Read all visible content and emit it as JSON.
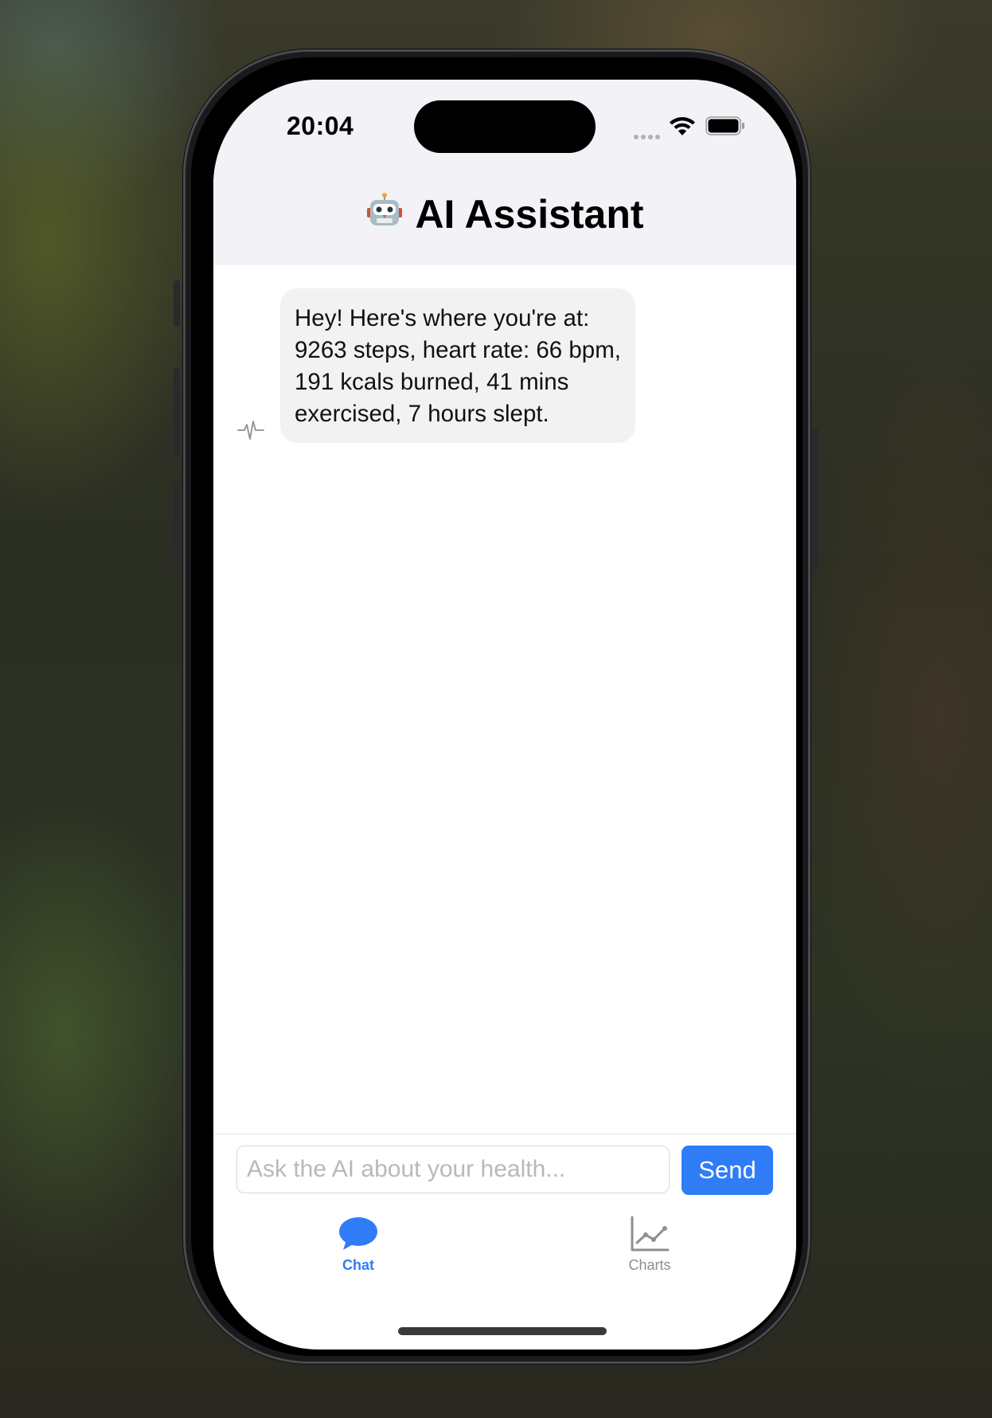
{
  "status_bar": {
    "time": "20:04"
  },
  "header": {
    "title": "AI Assistant",
    "icon": "robot-icon"
  },
  "chat": {
    "messages": [
      {
        "sender": "assistant",
        "avatar_icon": "heart-pulse-icon",
        "text": "Hey! Here's where you're at: 9263 steps, heart rate: 66 bpm, 191 kcals burned, 41 mins exercised, 7 hours slept."
      }
    ]
  },
  "composer": {
    "placeholder": "Ask the AI about your health...",
    "value": "",
    "send_label": "Send"
  },
  "tabs": [
    {
      "label": "Chat",
      "icon": "chat-bubble-icon",
      "active": true
    },
    {
      "label": "Charts",
      "icon": "line-chart-icon",
      "active": false
    }
  ],
  "colors": {
    "accent": "#2f7cf6",
    "header_bg": "#f2f2f7",
    "bubble_bg": "#f2f2f2",
    "inactive_tab": "#8e8e93"
  }
}
